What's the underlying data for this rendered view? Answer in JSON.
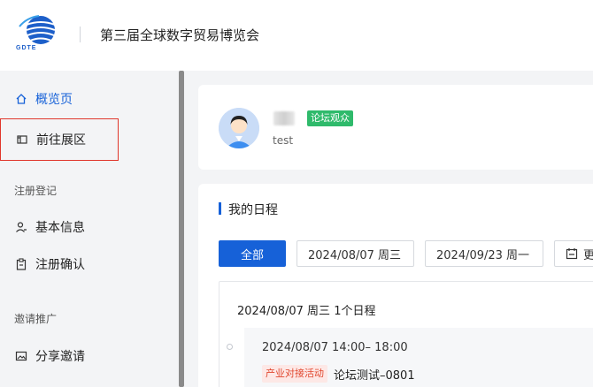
{
  "header": {
    "logo_text": "GDTE",
    "title": "第三届全球数字贸易博览会"
  },
  "sidebar": {
    "items": [
      {
        "label": "概览页",
        "icon": "home-icon"
      },
      {
        "label": "前往展区",
        "icon": "exhibition-icon"
      }
    ],
    "groups": [
      {
        "title": "注册登记",
        "items": [
          {
            "label": "基本信息",
            "icon": "user-icon"
          },
          {
            "label": "注册确认",
            "icon": "clipboard-icon"
          }
        ]
      },
      {
        "title": "邀请推广",
        "items": [
          {
            "label": "分享邀请",
            "icon": "image-icon"
          }
        ]
      }
    ]
  },
  "profile": {
    "role_tag": "论坛观众",
    "username": "test"
  },
  "schedule": {
    "title": "我的日程",
    "filter_all": "全部",
    "date_start": "2024/08/07 周三",
    "date_end": "2024/09/23 周一",
    "more_label": "更",
    "day_header": "2024/08/07  周三  1个日程",
    "event": {
      "time": "2024/08/07 14:00– 18:00",
      "tag": "产业对接活动",
      "name": "论坛测试–0801"
    }
  },
  "colors": {
    "accent": "#1661d8",
    "role_tag_bg": "#2fba6b",
    "event_tag_bg": "#fde8e6",
    "event_tag_text": "#e1472f",
    "highlight_border": "#e0362b"
  }
}
